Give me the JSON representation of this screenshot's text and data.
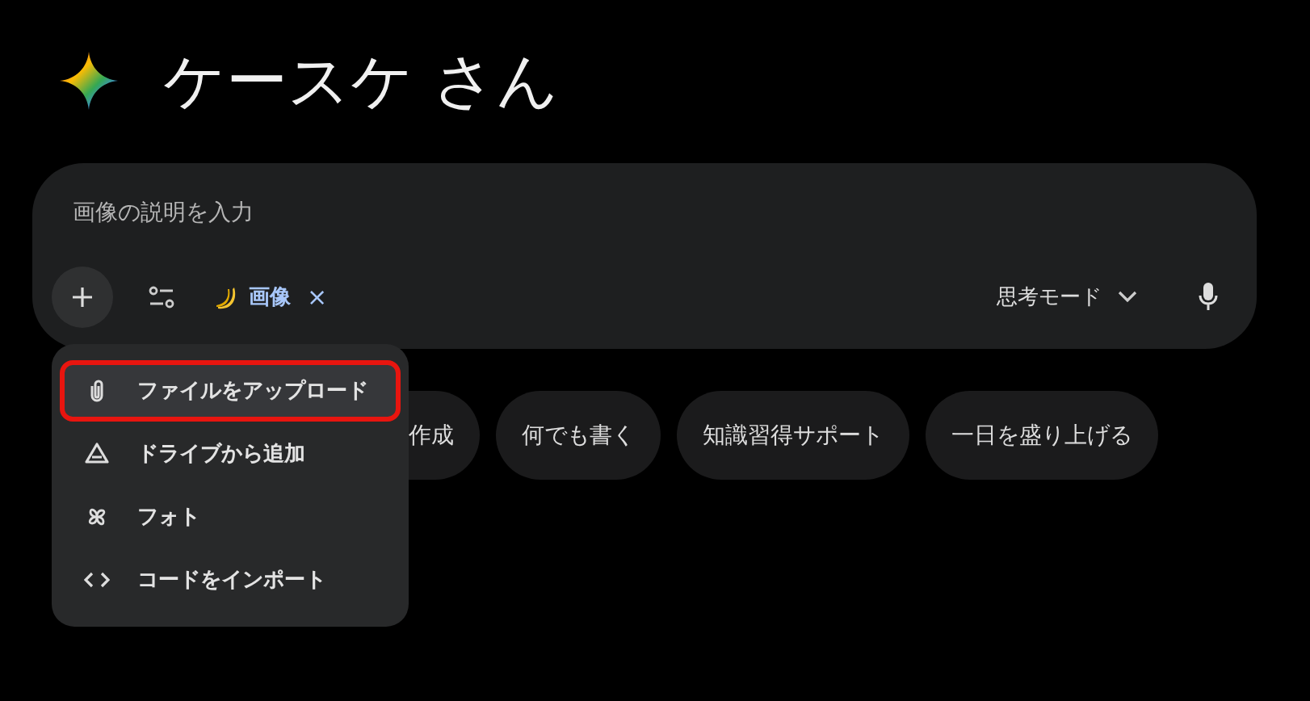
{
  "greeting": "ケースケ さん",
  "prompt": {
    "placeholder": "画像の説明を入力",
    "tool_chip": {
      "label": "画像",
      "close": "×"
    },
    "mode": "思考モード"
  },
  "suggestions": [
    {
      "label": "作成"
    },
    {
      "label": "何でも書く"
    },
    {
      "label": "知識習得サポート"
    },
    {
      "label": "一日を盛り上げる"
    }
  ],
  "menu": {
    "items": [
      {
        "kind": "paperclip",
        "label": "ファイルをアップロード",
        "highlighted": true
      },
      {
        "kind": "drive",
        "label": "ドライブから追加",
        "highlighted": false
      },
      {
        "kind": "pinwheel",
        "label": "フォト",
        "highlighted": false
      },
      {
        "kind": "code",
        "label": "コードをインポート",
        "highlighted": false
      }
    ]
  }
}
